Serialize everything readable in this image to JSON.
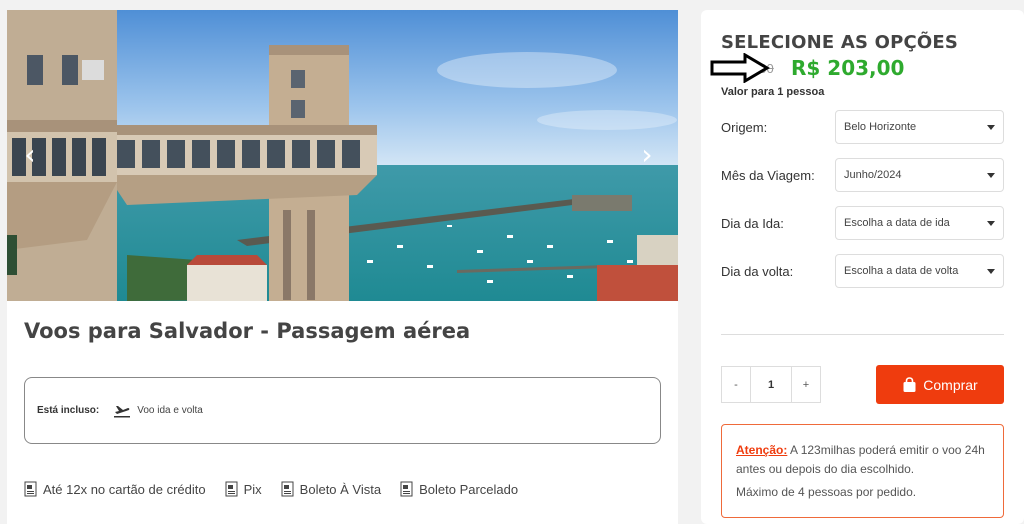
{
  "product": {
    "title": "Voos para Salvador - Passagem aérea",
    "included_label": "Está incluso:",
    "included_value": "Voo ida e volta"
  },
  "gallery": {
    "prev_icon": "chevron-left-icon",
    "next_icon": "chevron-right-icon"
  },
  "payments": [
    {
      "label": "Até 12x no cartão de crédito",
      "icon": "receipt-icon"
    },
    {
      "label": "Pix",
      "icon": "receipt-icon"
    },
    {
      "label": "Boleto À Vista",
      "icon": "receipt-icon"
    },
    {
      "label": "Boleto Parcelado",
      "icon": "receipt-icon"
    }
  ],
  "options": {
    "title": "SELECIONE AS OPÇÕES",
    "old_price": "R$ 00,00",
    "new_price": "R$ 203,00",
    "per_person": "Valor para 1 pessoa",
    "fields": [
      {
        "label": "Origem:",
        "value": "Belo Horizonte"
      },
      {
        "label": "Mês da Viagem:",
        "value": "Junho/2024"
      },
      {
        "label": "Dia da Ida:",
        "value": "Escolha a data de ida"
      },
      {
        "label": "Dia da volta:",
        "value": "Escolha a data de volta"
      }
    ],
    "quantity": {
      "minus": "-",
      "value": "1",
      "plus": "+"
    },
    "buy_label": "Comprar",
    "notice": {
      "strong": "Atenção:",
      "text": " A 123milhas poderá emitir o voo 24h antes ou depois do dia escolhido.",
      "max": "Máximo de 4 pessoas por pedido."
    }
  },
  "colors": {
    "accent": "#ef3c0e",
    "price_green": "#2eaa2e",
    "notice_border": "#ef6a3a"
  }
}
